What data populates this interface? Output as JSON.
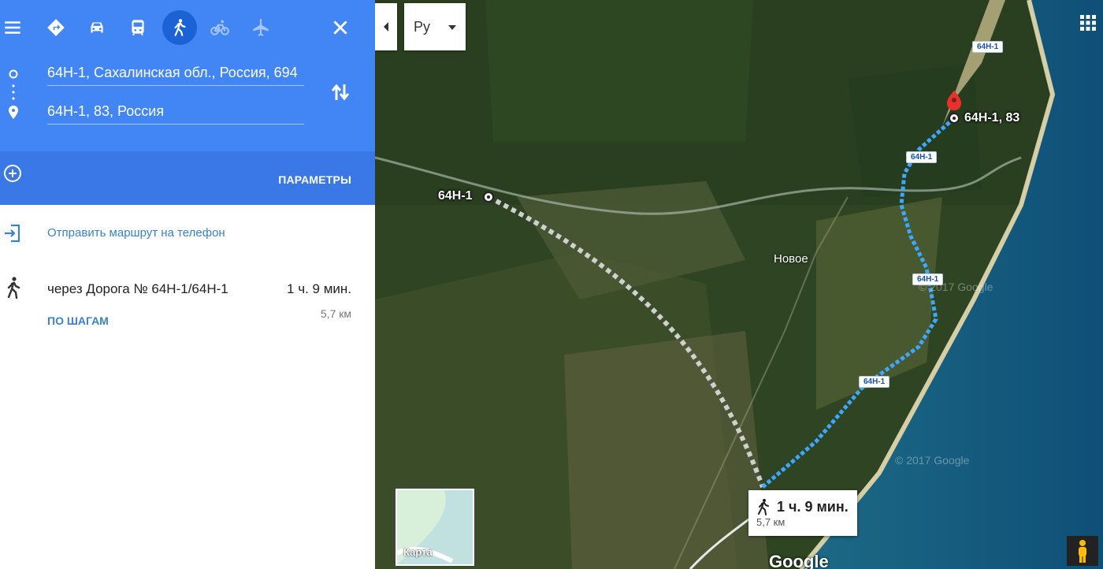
{
  "travel_modes": [
    {
      "name": "best",
      "icon": "route-icon"
    },
    {
      "name": "driving",
      "icon": "car-icon"
    },
    {
      "name": "transit",
      "icon": "bus-icon"
    },
    {
      "name": "walking",
      "icon": "walk-icon",
      "active": true
    },
    {
      "name": "cycling",
      "icon": "bike-icon"
    },
    {
      "name": "flights",
      "icon": "plane-icon"
    }
  ],
  "directions": {
    "origin": "64H-1, Сахалинская обл., Россия, 694",
    "destination": "64H-1, 83, Россия"
  },
  "options": {
    "params_label": "ПАРАМЕТРЫ"
  },
  "send": {
    "label": "Отправить маршрут на телефон"
  },
  "route": {
    "via": "через Дорога № 64H-1/64H-1",
    "duration": "1 ч. 9 мин.",
    "distance": "5,7 км",
    "steps_label": "ПО ШАГАМ"
  },
  "map": {
    "lang_label": "Ру",
    "origin_label": "64H-1",
    "dest_label": "64H-1, 83",
    "town": "Новое",
    "road_shields": [
      "64H-1",
      "64H-1",
      "64H-1",
      "64H-1"
    ],
    "callout_duration": "1 ч. 9 мин.",
    "callout_distance": "5,7 км",
    "minimap_label": "Карта",
    "google_logo": "Google",
    "copyright": "© 2017 Google"
  },
  "colors": {
    "primary": "#4285f4",
    "secondary": "#3b78e7",
    "link": "#3a82c3",
    "route": "#3ea7ff"
  }
}
